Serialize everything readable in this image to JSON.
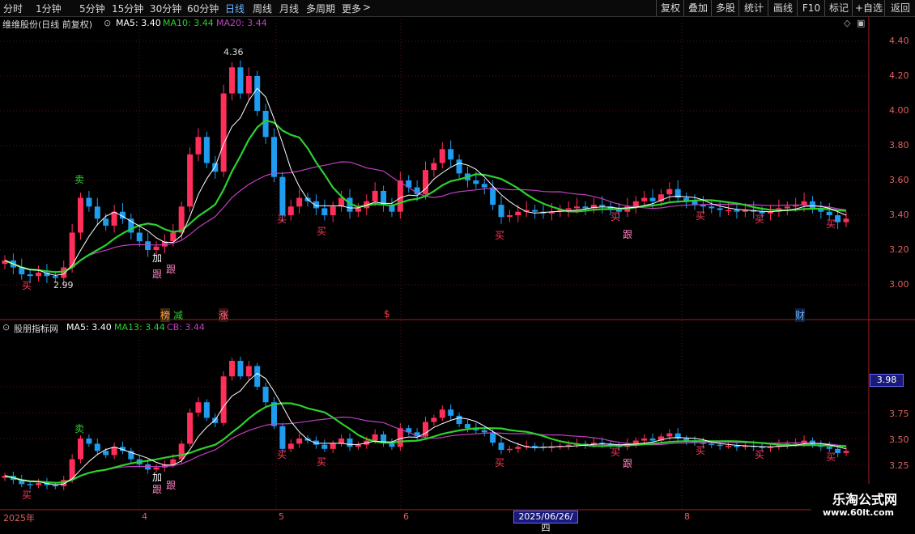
{
  "toolbar": {
    "periods": [
      "分时",
      "1分钟",
      "5分钟",
      "15分钟",
      "30分钟",
      "60分钟",
      "日线",
      "周线",
      "月线",
      "多周期",
      "更多"
    ],
    "active": "日线",
    "right": [
      "复权",
      "叠加",
      "多股",
      "统计",
      "画线",
      "F10",
      "标记",
      "+自选",
      "返回"
    ]
  },
  "main": {
    "title": "维维股份(日线 前复权)",
    "ma5": "MA5: 3.40",
    "ma10": "MA10: 3.44",
    "ma20": "MA20: 3.44",
    "yticks": [
      "4.40",
      "4.20",
      "4.00",
      "3.80",
      "3.60",
      "3.40",
      "3.20",
      "3.00"
    ],
    "high_label": "4.36",
    "low_label": "2.99"
  },
  "sub": {
    "title": "股朋指标网",
    "ma5": "MA5: 3.40",
    "ma13": "MA13: 3.44",
    "cb": "CB: 3.44",
    "yticks": [
      "3.75",
      "3.50",
      "3.25"
    ],
    "cross_value": "3.98"
  },
  "events": {
    "bang": "榜",
    "jian": "减",
    "zhang": "涨",
    "dollar": "$",
    "cai": "财"
  },
  "signals": {
    "sell": "卖",
    "buy": "买",
    "add": "加",
    "follow": "跟"
  },
  "dates": {
    "y2025": "2025年",
    "m4": "4",
    "m5": "5",
    "m6": "6",
    "m8": "8",
    "cursor": "2025/06/26/四"
  },
  "watermark": {
    "line1": "乐淘公式网",
    "line2": "www.60lt.com"
  },
  "colors": {
    "up": "#ff2e5a",
    "down": "#1e9cf0",
    "ma5": "#ffffff",
    "ma_green": "#2cd12c",
    "ma_purple": "#c040c0",
    "axis": "#e06060"
  },
  "chart_data": {
    "type": "candlestick",
    "closes": [
      3.14,
      3.1,
      3.06,
      3.05,
      3.07,
      3.05,
      3.04,
      3.1,
      3.3,
      3.5,
      3.45,
      3.38,
      3.34,
      3.42,
      3.38,
      3.3,
      3.25,
      3.2,
      3.22,
      3.25,
      3.3,
      3.45,
      3.75,
      3.85,
      3.7,
      3.65,
      4.1,
      4.25,
      4.1,
      4.2,
      4.0,
      3.85,
      3.62,
      3.4,
      3.45,
      3.5,
      3.48,
      3.44,
      3.4,
      3.45,
      3.5,
      3.42,
      3.44,
      3.48,
      3.54,
      3.46,
      3.42,
      3.6,
      3.56,
      3.52,
      3.66,
      3.7,
      3.78,
      3.72,
      3.64,
      3.6,
      3.58,
      3.56,
      3.46,
      3.39,
      3.4,
      3.42,
      3.43,
      3.42,
      3.41,
      3.42,
      3.43,
      3.44,
      3.45,
      3.44,
      3.46,
      3.45,
      3.43,
      3.42,
      3.45,
      3.48,
      3.5,
      3.48,
      3.52,
      3.55,
      3.5,
      3.48,
      3.46,
      3.45,
      3.44,
      3.43,
      3.43,
      3.42,
      3.43,
      3.42,
      3.41,
      3.42,
      3.44,
      3.45,
      3.46,
      3.48,
      3.44,
      3.42,
      3.4,
      3.36,
      3.38
    ]
  }
}
